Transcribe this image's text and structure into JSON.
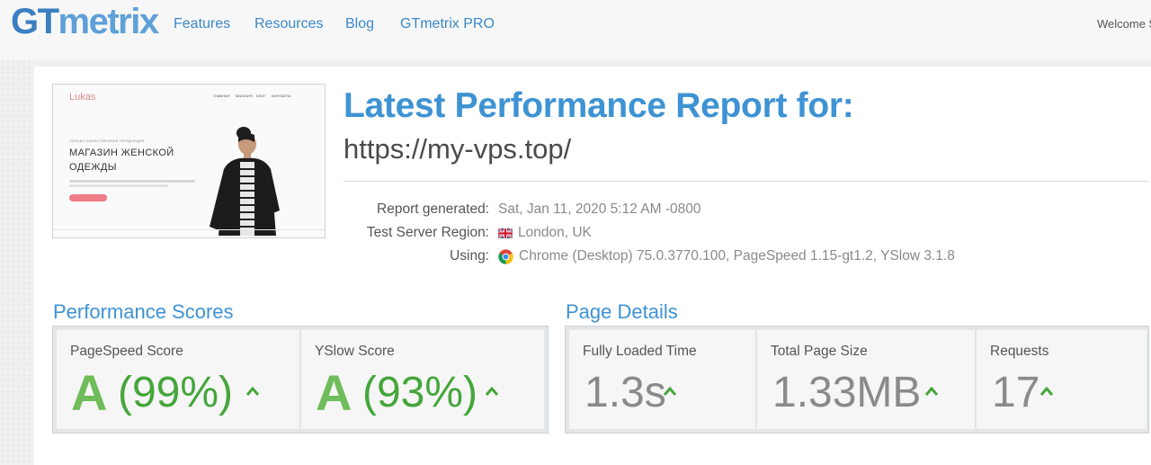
{
  "brand": {
    "gt": "GT",
    "metrix": "metrix"
  },
  "nav": {
    "features": "Features",
    "resources": "Resources",
    "blog": "Blog",
    "pro": "GTmetrix PRO"
  },
  "welcome_text": "Welcome S",
  "thumbnail": {
    "site_logo": "Lukas",
    "nav_items": [
      "ГЛАВНАЯ",
      "МАГАЗИН",
      "БЛОГ",
      "КОНТАКТЫ"
    ],
    "tagline": "ТОЛЬКО КАЧЕСТВЕННАЯ ПРОДУКЦИЯ",
    "headline_line1": "МАГАЗИН ЖЕНСКОЙ",
    "headline_line2": "ОДЕЖДЫ"
  },
  "report": {
    "title": "Latest Performance Report for:",
    "url": "https://my-vps.top/",
    "generated_label": "Report generated:",
    "generated_value": "Sat, Jan 11, 2020 5:12 AM -0800",
    "region_label": "Test Server Region:",
    "region_value": "London, UK",
    "using_label": "Using:",
    "using_value": "Chrome (Desktop) 75.0.3770.100, PageSpeed 1.15-gt1.2, YSlow 3.1.8"
  },
  "performance": {
    "title": "Performance Scores",
    "pagespeed_label": "PageSpeed Score",
    "pagespeed_grade": "A",
    "pagespeed_pct": "(99%)",
    "yslow_label": "YSlow Score",
    "yslow_grade": "A",
    "yslow_pct": "(93%)"
  },
  "details": {
    "title": "Page Details",
    "loaded_label": "Fully Loaded Time",
    "loaded_value": "1.3s",
    "size_label": "Total Page Size",
    "size_value": "1.33MB",
    "requests_label": "Requests",
    "requests_value": "17"
  },
  "colors": {
    "brand_blue": "#3d93d3",
    "grade_green": "#45a63b",
    "muted_gray": "#8a8a8a"
  }
}
